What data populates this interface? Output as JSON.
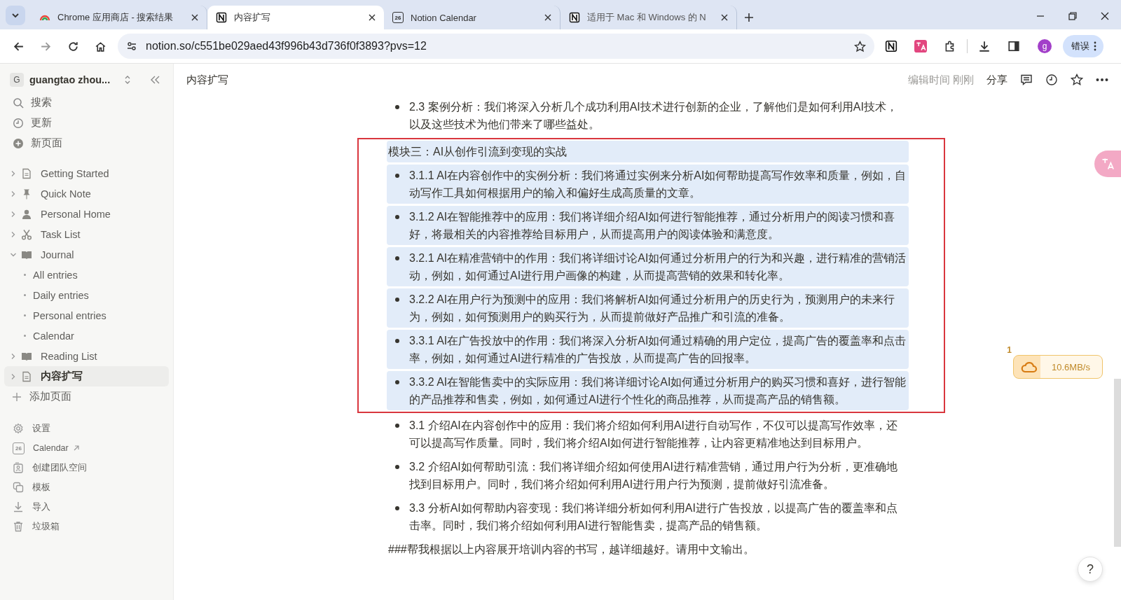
{
  "browser": {
    "tabs": [
      {
        "title": "Chrome 应用商店 - 搜索结果",
        "kind": "webstore",
        "selected": false
      },
      {
        "title": "内容扩写",
        "kind": "notion",
        "selected": true
      },
      {
        "title": "Notion Calendar",
        "kind": "calendar",
        "icon_text": "26",
        "selected": false
      },
      {
        "title": "适用于 Mac 和 Windows 的 N",
        "kind": "notion",
        "selected": false
      }
    ],
    "url": "notion.so/c551be029aed43f996b43d736f0f3893?pvs=12",
    "profile": "g",
    "status_button": "错误"
  },
  "sidebar": {
    "workspace": {
      "initial": "G",
      "name": "guangtao zhou..."
    },
    "nav": [
      {
        "label": "搜索",
        "kind": "search"
      },
      {
        "label": "更新",
        "kind": "clock"
      },
      {
        "label": "新页面",
        "kind": "new"
      }
    ],
    "pages": [
      {
        "label": "Getting Started",
        "kind": "doc",
        "expanded": false,
        "selected": false
      },
      {
        "label": "Quick Note",
        "kind": "pin",
        "expanded": false,
        "selected": false
      },
      {
        "label": "Personal Home",
        "kind": "person",
        "expanded": false,
        "selected": false
      },
      {
        "label": "Task List",
        "kind": "scissors",
        "expanded": false,
        "selected": false
      },
      {
        "label": "Journal",
        "kind": "book",
        "expanded": true,
        "selected": false,
        "children": [
          {
            "label": "All entries"
          },
          {
            "label": "Daily entries"
          },
          {
            "label": "Personal entries"
          },
          {
            "label": "Calendar"
          }
        ]
      },
      {
        "label": "Reading List",
        "kind": "book",
        "expanded": false,
        "selected": false
      },
      {
        "label": "内容扩写",
        "kind": "doc",
        "expanded": false,
        "selected": true
      }
    ],
    "add_page": "添加页面",
    "bottom": [
      {
        "label": "设置",
        "kind": "gear"
      },
      {
        "label": "Calendar",
        "kind": "calendar",
        "icon_text": "26",
        "external": true
      },
      {
        "label": "创建团队空间",
        "kind": "team"
      },
      {
        "label": "模板",
        "kind": "template"
      },
      {
        "label": "导入",
        "kind": "import"
      },
      {
        "label": "垃圾箱",
        "kind": "trash"
      }
    ]
  },
  "page": {
    "breadcrumb": "内容扩写",
    "edited": "编辑时间 刚刚",
    "share": "分享",
    "blocks": [
      {
        "kind": "bullet",
        "selected": false,
        "text": "2.3 案例分析：我们将深入分析几个成功利用AI技术进行创新的企业，了解他们是如何利用AI技术，以及这些技术为他们带来了哪些益处。"
      },
      {
        "kind": "text",
        "selected": true,
        "text": "模块三：AI从创作引流到变现的实战"
      },
      {
        "kind": "bullet",
        "selected": true,
        "text": "3.1.1 AI在内容创作中的实例分析：我们将通过实例来分析AI如何帮助提高写作效率和质量，例如，自动写作工具如何根据用户的输入和偏好生成高质量的文章。"
      },
      {
        "kind": "bullet",
        "selected": true,
        "text": "3.1.2 AI在智能推荐中的应用：我们将详细介绍AI如何进行智能推荐，通过分析用户的阅读习惯和喜好，将最相关的内容推荐给目标用户，从而提高用户的阅读体验和满意度。"
      },
      {
        "kind": "bullet",
        "selected": true,
        "text": "3.2.1 AI在精准营销中的作用：我们将详细讨论AI如何通过分析用户的行为和兴趣，进行精准的营销活动，例如，如何通过AI进行用户画像的构建，从而提高营销的效果和转化率。"
      },
      {
        "kind": "bullet",
        "selected": true,
        "text": "3.2.2 AI在用户行为预测中的应用：我们将解析AI如何通过分析用户的历史行为，预测用户的未来行为，例如，如何预测用户的购买行为，从而提前做好产品推广和引流的准备。"
      },
      {
        "kind": "bullet",
        "selected": true,
        "text": "3.3.1 AI在广告投放中的作用：我们将深入分析AI如何通过精确的用户定位，提高广告的覆盖率和点击率，例如，如何通过AI进行精准的广告投放，从而提高广告的回报率。"
      },
      {
        "kind": "bullet",
        "selected": true,
        "text": "3.3.2 AI在智能售卖中的实际应用：我们将详细讨论AI如何通过分析用户的购买习惯和喜好，进行智能的产品推荐和售卖，例如，如何通过AI进行个性化的商品推荐，从而提高产品的销售额。"
      },
      {
        "kind": "bullet",
        "selected": false,
        "text": "3.1 介绍AI在内容创作中的应用：我们将介绍如何利用AI进行自动写作，不仅可以提高写作效率，还可以提高写作质量。同时，我们将介绍AI如何进行智能推荐，让内容更精准地达到目标用户。"
      },
      {
        "kind": "bullet",
        "selected": false,
        "text": "3.2 介绍AI如何帮助引流：我们将详细介绍如何使用AI进行精准营销，通过用户行为分析，更准确地找到目标用户。同时，我们将介绍如何利用AI进行用户行为预测，提前做好引流准备。"
      },
      {
        "kind": "bullet",
        "selected": false,
        "text": "3.3 分析AI如何帮助内容变现：我们将详细分析如何利用AI进行广告投放，以提高广告的覆盖率和点击率。同时，我们将介绍如何利用AI进行智能售卖，提高产品的销售额。"
      },
      {
        "kind": "text",
        "selected": false,
        "text": "###帮我根据以上内容展开培训内容的书写，越详细越好。请用中文输出。"
      }
    ]
  },
  "download": {
    "count": "1",
    "speed": "10.6MB/s"
  },
  "help": "?"
}
